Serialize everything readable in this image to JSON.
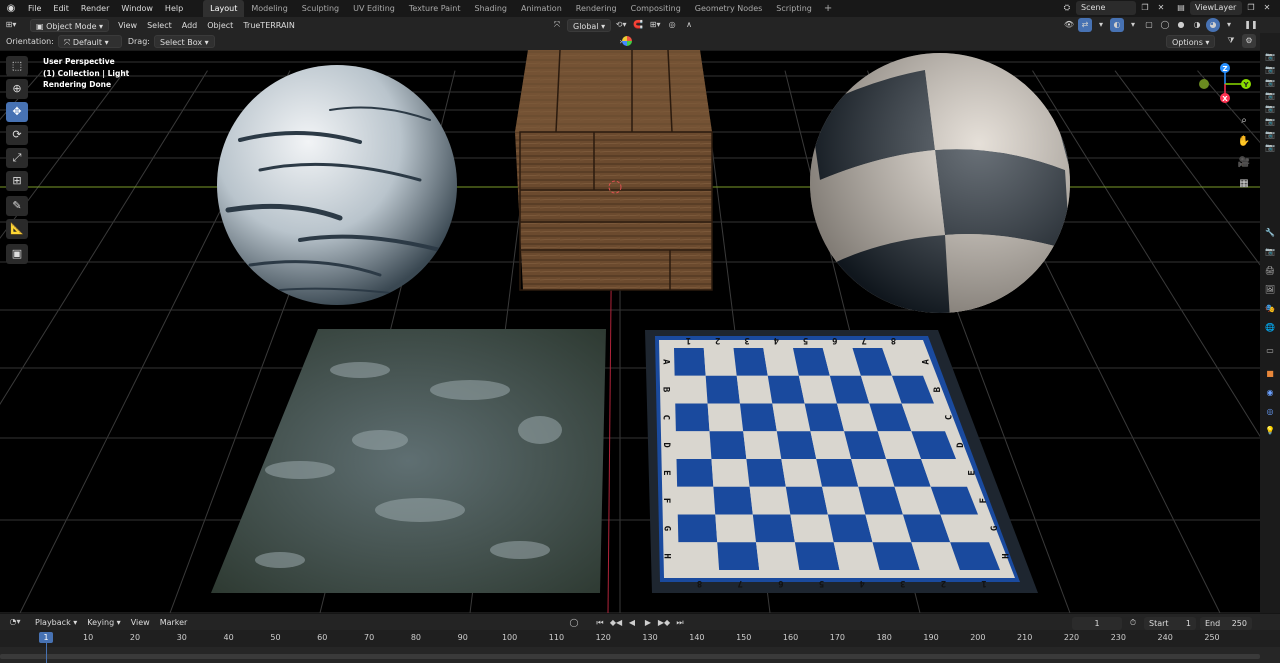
{
  "top_menu": {
    "items": [
      "File",
      "Edit",
      "Render",
      "Window",
      "Help"
    ],
    "workspaces": [
      "Layout",
      "Modeling",
      "Sculpting",
      "UV Editing",
      "Texture Paint",
      "Shading",
      "Animation",
      "Rendering",
      "Compositing",
      "Geometry Nodes",
      "Scripting"
    ],
    "active_workspace": "Layout",
    "add_workspace": "+",
    "scene": "Scene",
    "view_layer": "ViewLayer"
  },
  "viewport_header": {
    "mode": "Object Mode",
    "menus": [
      "View",
      "Select",
      "Add",
      "Object",
      "TrueTERRAIN"
    ],
    "transform_orientation": "Global",
    "options": "Options"
  },
  "tool_settings": {
    "orientation_label": "Orientation:",
    "orientation_value": "Default",
    "drag_label": "Drag:",
    "drag_value": "Select Box"
  },
  "overlay": {
    "perspective": "User Perspective",
    "collection": "(1) Collection | Light",
    "status": "Rendering Done"
  },
  "gizmo": {
    "x": "X",
    "y": "Y",
    "z": "Z"
  },
  "chessboard": {
    "numbers": [
      "8",
      "7",
      "6",
      "5",
      "4",
      "3",
      "2",
      "1"
    ],
    "letters": [
      "A",
      "B",
      "C",
      "D",
      "E",
      "F",
      "G",
      "H"
    ]
  },
  "timeline": {
    "menus": [
      "Playback",
      "Keying",
      "View",
      "Marker"
    ],
    "current_frame": "1",
    "start_label": "Start",
    "start_value": "1",
    "end_label": "End",
    "end_value": "250",
    "ruler": [
      "1",
      "10",
      "20",
      "30",
      "40",
      "50",
      "60",
      "70",
      "80",
      "90",
      "100",
      "110",
      "120",
      "130",
      "140",
      "150",
      "160",
      "170",
      "180",
      "190",
      "200",
      "210",
      "220",
      "230",
      "240",
      "250"
    ]
  },
  "colors": {
    "accent": "#4772b3",
    "x_axis": "#ff3352",
    "y_axis": "#8bdc00",
    "z_axis": "#2890ff",
    "board_blue": "#1a4a9e",
    "board_light": "#d9d6cf"
  }
}
